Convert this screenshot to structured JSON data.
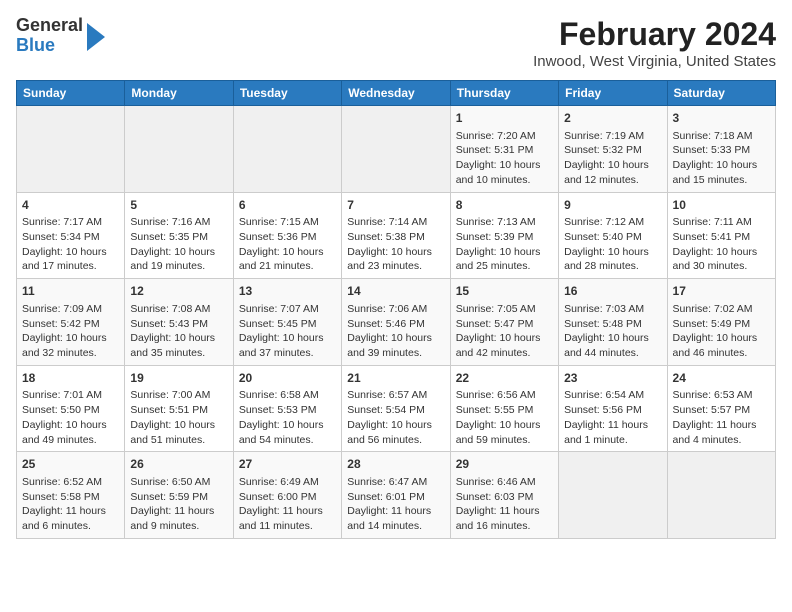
{
  "header": {
    "logo_general": "General",
    "logo_blue": "Blue",
    "title": "February 2024",
    "subtitle": "Inwood, West Virginia, United States"
  },
  "columns": [
    "Sunday",
    "Monday",
    "Tuesday",
    "Wednesday",
    "Thursday",
    "Friday",
    "Saturday"
  ],
  "weeks": [
    [
      {
        "day": "",
        "info": ""
      },
      {
        "day": "",
        "info": ""
      },
      {
        "day": "",
        "info": ""
      },
      {
        "day": "",
        "info": ""
      },
      {
        "day": "1",
        "info": "Sunrise: 7:20 AM\nSunset: 5:31 PM\nDaylight: 10 hours\nand 10 minutes."
      },
      {
        "day": "2",
        "info": "Sunrise: 7:19 AM\nSunset: 5:32 PM\nDaylight: 10 hours\nand 12 minutes."
      },
      {
        "day": "3",
        "info": "Sunrise: 7:18 AM\nSunset: 5:33 PM\nDaylight: 10 hours\nand 15 minutes."
      }
    ],
    [
      {
        "day": "4",
        "info": "Sunrise: 7:17 AM\nSunset: 5:34 PM\nDaylight: 10 hours\nand 17 minutes."
      },
      {
        "day": "5",
        "info": "Sunrise: 7:16 AM\nSunset: 5:35 PM\nDaylight: 10 hours\nand 19 minutes."
      },
      {
        "day": "6",
        "info": "Sunrise: 7:15 AM\nSunset: 5:36 PM\nDaylight: 10 hours\nand 21 minutes."
      },
      {
        "day": "7",
        "info": "Sunrise: 7:14 AM\nSunset: 5:38 PM\nDaylight: 10 hours\nand 23 minutes."
      },
      {
        "day": "8",
        "info": "Sunrise: 7:13 AM\nSunset: 5:39 PM\nDaylight: 10 hours\nand 25 minutes."
      },
      {
        "day": "9",
        "info": "Sunrise: 7:12 AM\nSunset: 5:40 PM\nDaylight: 10 hours\nand 28 minutes."
      },
      {
        "day": "10",
        "info": "Sunrise: 7:11 AM\nSunset: 5:41 PM\nDaylight: 10 hours\nand 30 minutes."
      }
    ],
    [
      {
        "day": "11",
        "info": "Sunrise: 7:09 AM\nSunset: 5:42 PM\nDaylight: 10 hours\nand 32 minutes."
      },
      {
        "day": "12",
        "info": "Sunrise: 7:08 AM\nSunset: 5:43 PM\nDaylight: 10 hours\nand 35 minutes."
      },
      {
        "day": "13",
        "info": "Sunrise: 7:07 AM\nSunset: 5:45 PM\nDaylight: 10 hours\nand 37 minutes."
      },
      {
        "day": "14",
        "info": "Sunrise: 7:06 AM\nSunset: 5:46 PM\nDaylight: 10 hours\nand 39 minutes."
      },
      {
        "day": "15",
        "info": "Sunrise: 7:05 AM\nSunset: 5:47 PM\nDaylight: 10 hours\nand 42 minutes."
      },
      {
        "day": "16",
        "info": "Sunrise: 7:03 AM\nSunset: 5:48 PM\nDaylight: 10 hours\nand 44 minutes."
      },
      {
        "day": "17",
        "info": "Sunrise: 7:02 AM\nSunset: 5:49 PM\nDaylight: 10 hours\nand 46 minutes."
      }
    ],
    [
      {
        "day": "18",
        "info": "Sunrise: 7:01 AM\nSunset: 5:50 PM\nDaylight: 10 hours\nand 49 minutes."
      },
      {
        "day": "19",
        "info": "Sunrise: 7:00 AM\nSunset: 5:51 PM\nDaylight: 10 hours\nand 51 minutes."
      },
      {
        "day": "20",
        "info": "Sunrise: 6:58 AM\nSunset: 5:53 PM\nDaylight: 10 hours\nand 54 minutes."
      },
      {
        "day": "21",
        "info": "Sunrise: 6:57 AM\nSunset: 5:54 PM\nDaylight: 10 hours\nand 56 minutes."
      },
      {
        "day": "22",
        "info": "Sunrise: 6:56 AM\nSunset: 5:55 PM\nDaylight: 10 hours\nand 59 minutes."
      },
      {
        "day": "23",
        "info": "Sunrise: 6:54 AM\nSunset: 5:56 PM\nDaylight: 11 hours\nand 1 minute."
      },
      {
        "day": "24",
        "info": "Sunrise: 6:53 AM\nSunset: 5:57 PM\nDaylight: 11 hours\nand 4 minutes."
      }
    ],
    [
      {
        "day": "25",
        "info": "Sunrise: 6:52 AM\nSunset: 5:58 PM\nDaylight: 11 hours\nand 6 minutes."
      },
      {
        "day": "26",
        "info": "Sunrise: 6:50 AM\nSunset: 5:59 PM\nDaylight: 11 hours\nand 9 minutes."
      },
      {
        "day": "27",
        "info": "Sunrise: 6:49 AM\nSunset: 6:00 PM\nDaylight: 11 hours\nand 11 minutes."
      },
      {
        "day": "28",
        "info": "Sunrise: 6:47 AM\nSunset: 6:01 PM\nDaylight: 11 hours\nand 14 minutes."
      },
      {
        "day": "29",
        "info": "Sunrise: 6:46 AM\nSunset: 6:03 PM\nDaylight: 11 hours\nand 16 minutes."
      },
      {
        "day": "",
        "info": ""
      },
      {
        "day": "",
        "info": ""
      }
    ]
  ]
}
